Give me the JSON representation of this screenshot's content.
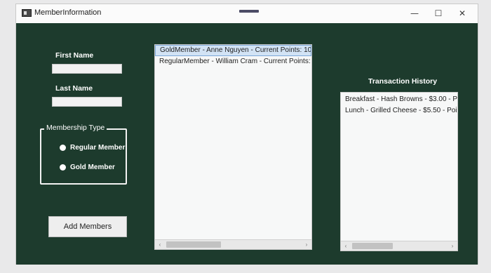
{
  "window": {
    "title": "MemberInformation",
    "minimize_glyph": "—",
    "maximize_glyph": "☐",
    "close_glyph": "✕"
  },
  "form": {
    "first_name_label": "First Name",
    "first_name_value": "",
    "last_name_label": "Last Name",
    "last_name_value": "",
    "membership_type_label": "Membership Type",
    "radio_options": [
      "Regular Member",
      "Gold Member"
    ],
    "add_button_label": "Add Members"
  },
  "members_list": {
    "items": [
      "GoldMember - Anne Nguyen - Current Points: 10",
      "RegularMember - William Cram - Current Points: "
    ],
    "selected_index": 0
  },
  "transactions": {
    "label": "Transaction History",
    "items": [
      "Breakfast - Hash Browns - $3.00 - Po",
      "Lunch - Grilled Cheese - $5.50 - Poi"
    ]
  },
  "icons": {
    "scroll_left": "‹",
    "scroll_right": "›"
  }
}
